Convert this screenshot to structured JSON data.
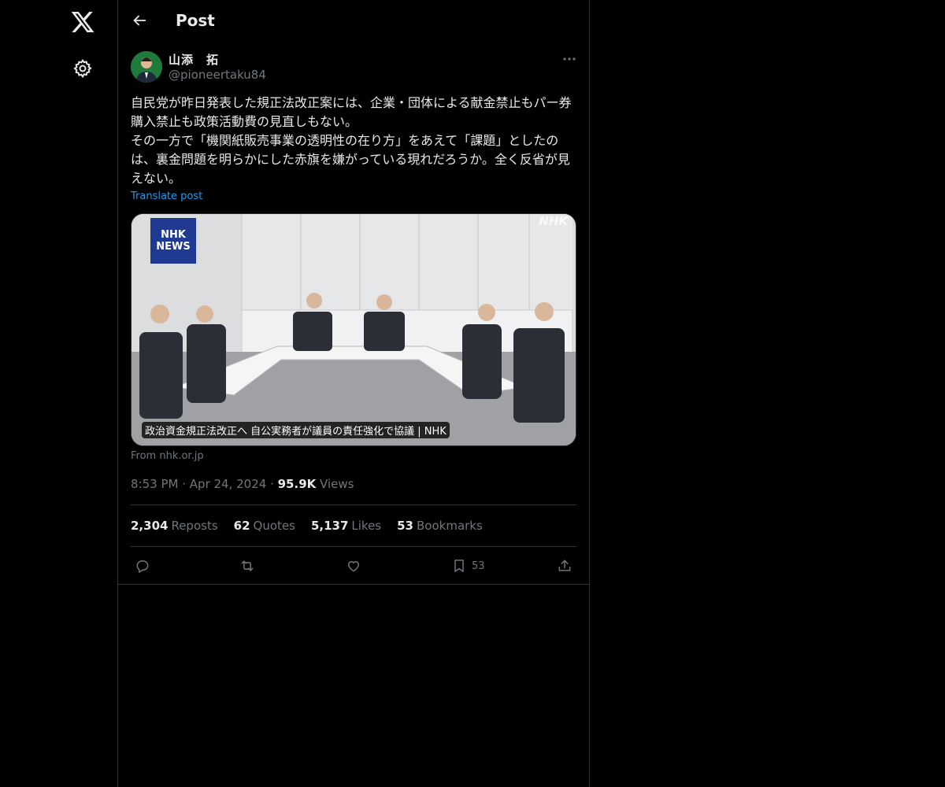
{
  "nav": {
    "logo_icon": "x-logo-icon",
    "settings_icon": "gear-icon",
    "back_icon": "arrow-left-icon"
  },
  "header": {
    "title": "Post"
  },
  "post": {
    "author_name": "山添　拓",
    "author_handle": "@pioneertaku84",
    "text": "自民党が昨日発表した規正法改正案には、企業・団体による献金禁止もパー券購入禁止も政策活動費の見直しもない。\nその一方で「機関紙販売事業の透明性の在り方」をあえて「課題」としたのは、裏金問題を明らかにした赤旗を嫌がっている現れだろうか。全く反省が見えない。",
    "translate_label": "Translate post",
    "media": {
      "badge_line1": "NHK",
      "badge_line2": "NEWS",
      "watermark": "NHK",
      "caption": "政治資金規正法改正へ 自公実務者が議員の責任強化で協議 | NHK",
      "source": "From nhk.or.jp"
    },
    "time": "8:53 PM",
    "date": "Apr 24, 2024",
    "views_count": "95.9K",
    "views_label": "Views",
    "stats": {
      "reposts_count": "2,304",
      "reposts_label": "Reposts",
      "quotes_count": "62",
      "quotes_label": "Quotes",
      "likes_count": "5,137",
      "likes_label": "Likes",
      "bookmarks_count": "53",
      "bookmarks_label": "Bookmarks"
    },
    "actions": {
      "bookmark_count": "53"
    }
  },
  "colors": {
    "background": "#000000",
    "text": "#e7e9ea",
    "muted": "#71767b",
    "link": "#1d9bf0",
    "border": "#2f3336"
  }
}
